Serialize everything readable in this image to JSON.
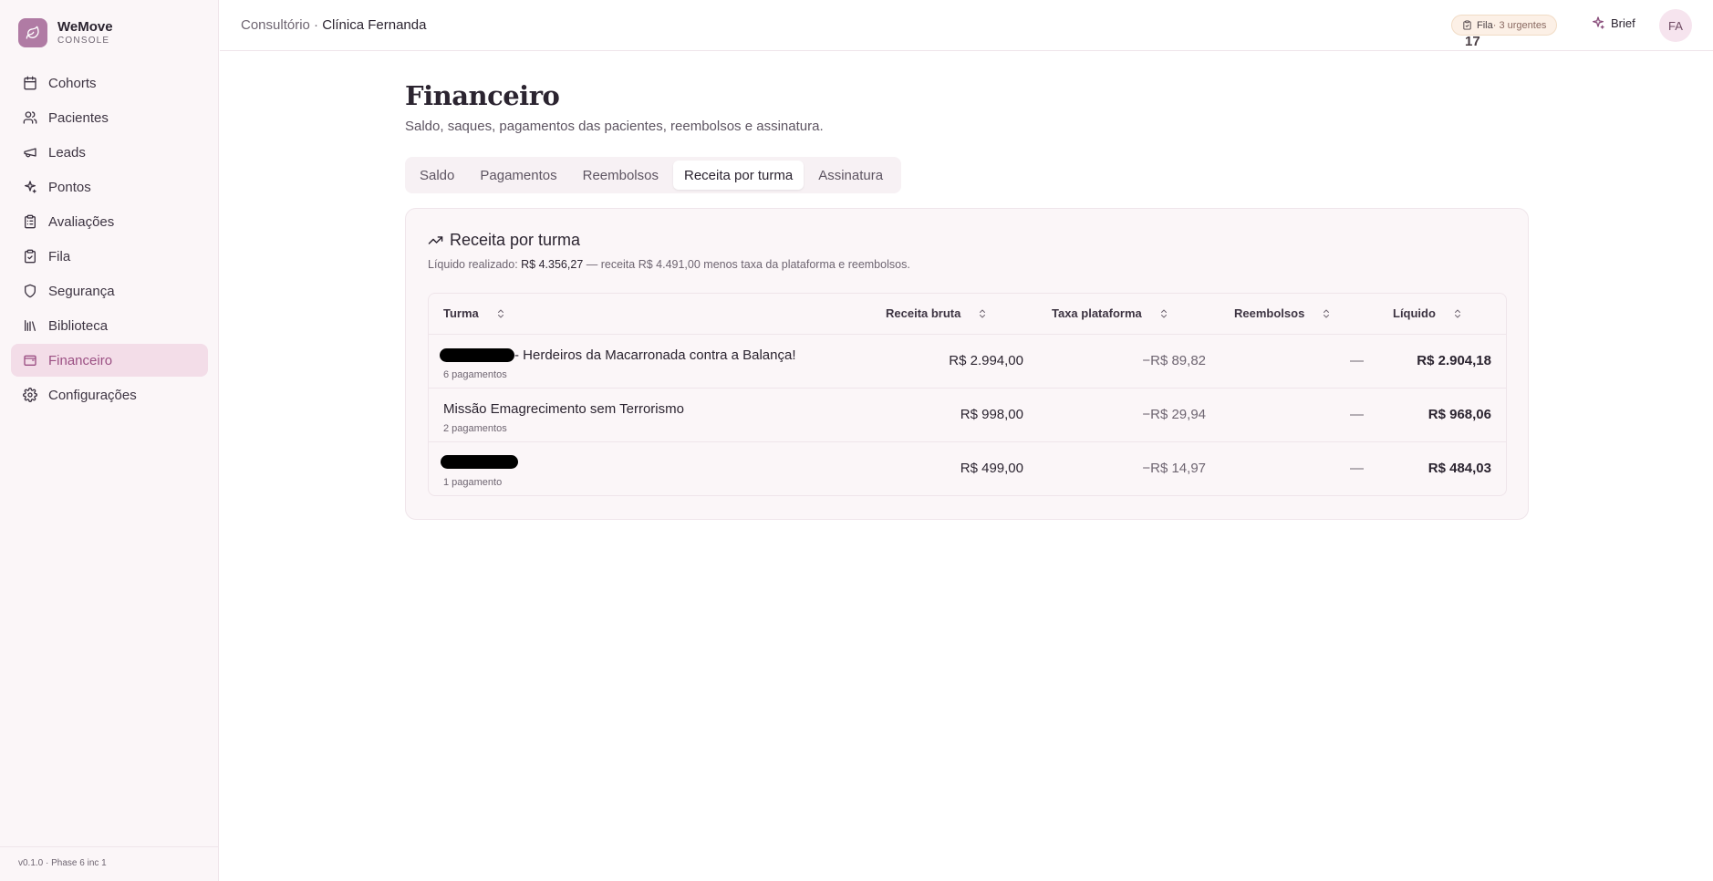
{
  "brand": {
    "name": "WeMove",
    "sub": "CONSOLE",
    "logo_icon": "leaf-icon"
  },
  "sidebar": {
    "items": [
      {
        "label": "Cohorts",
        "icon": "calendar-icon",
        "active": false
      },
      {
        "label": "Pacientes",
        "icon": "users-icon",
        "active": false
      },
      {
        "label": "Leads",
        "icon": "megaphone-icon",
        "active": false
      },
      {
        "label": "Pontos",
        "icon": "sparkles-icon",
        "active": false
      },
      {
        "label": "Avaliações",
        "icon": "clipboard-list-icon",
        "active": false
      },
      {
        "label": "Fila",
        "icon": "clipboard-check-icon",
        "active": false
      },
      {
        "label": "Segurança",
        "icon": "shield-icon",
        "active": false
      },
      {
        "label": "Biblioteca",
        "icon": "library-icon",
        "active": false
      },
      {
        "label": "Financeiro",
        "icon": "wallet-icon",
        "active": true
      },
      {
        "label": "Configurações",
        "icon": "gear-icon",
        "active": false
      }
    ],
    "version": "v0.1.0 · Phase 6 inc 1"
  },
  "topbar": {
    "crumb_prefix": "Consultório · ",
    "crumb_clinic": "Clínica Fernanda",
    "queue_label": "Fila",
    "queue_count": "17",
    "queue_urgent": "· 3 urgentes",
    "brief_label": "Brief",
    "avatar_initials": "FA"
  },
  "page": {
    "title": "Financeiro",
    "subtitle": "Saldo, saques, pagamentos das pacientes, reembolsos e assinatura."
  },
  "tabs": [
    {
      "label": "Saldo",
      "active": false
    },
    {
      "label": "Pagamentos",
      "active": false
    },
    {
      "label": "Reembolsos",
      "active": false
    },
    {
      "label": "Receita por turma",
      "active": true
    },
    {
      "label": "Assinatura",
      "active": false
    }
  ],
  "card": {
    "title": "Receita por turma",
    "note_prefix": "Líquido realizado: ",
    "note_value": "R$ 4.356,27",
    "note_suffix": " — receita R$ 4.491,00 menos taxa da plataforma e reembolsos."
  },
  "table": {
    "headers": {
      "turma": "Turma",
      "bruta": "Receita bruta",
      "taxa": "Taxa plataforma",
      "reembolsos": "Reembolsos",
      "liquido": "Líquido"
    },
    "rows": [
      {
        "name": "- Herdeiros da Macarronada contra a Balança!",
        "count": "6 pagamentos",
        "bruta": "R$ 2.994,00",
        "taxa": "−R$ 89,82",
        "reembolsos": "—",
        "liquido": "R$ 2.904,18"
      },
      {
        "name": "Missão Emagrecimento sem Terrorismo",
        "count": "2 pagamentos",
        "bruta": "R$ 998,00",
        "taxa": "−R$ 29,94",
        "reembolsos": "—",
        "liquido": "R$ 968,06"
      },
      {
        "name": "",
        "count": "1 pagamento",
        "bruta": "R$ 499,00",
        "taxa": "−R$ 14,97",
        "reembolsos": "—",
        "liquido": "R$ 484,03"
      }
    ]
  },
  "colors": {
    "accent": "#b07ba4",
    "active_nav_bg": "#f3dde8",
    "active_nav_text": "#9b4f83"
  }
}
